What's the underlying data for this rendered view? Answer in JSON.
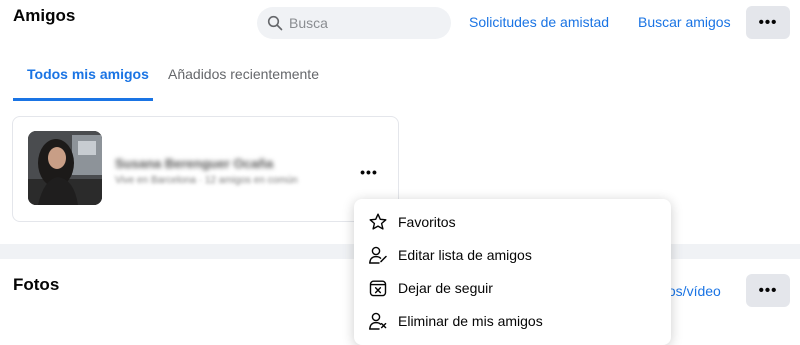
{
  "header": {
    "title": "Amigos",
    "search_placeholder": "Busca",
    "links": {
      "requests": "Solicitudes de amistad",
      "find": "Buscar amigos"
    },
    "more_label": "•••"
  },
  "tabs": [
    {
      "label": "Todos mis amigos",
      "active": true
    },
    {
      "label": "Añadidos recientemente",
      "active": false
    }
  ],
  "friend_card": {
    "name": "Susana Berenguer Ocaña",
    "meta": "Vive en Barcelona · 12 amigos en común",
    "more_label": "•••"
  },
  "context_menu": {
    "items": [
      {
        "label": "Favoritos",
        "icon": "star-icon"
      },
      {
        "label": "Editar lista de amigos",
        "icon": "edit-friend-list-icon"
      },
      {
        "label": "Dejar de seguir",
        "icon": "unfollow-icon"
      },
      {
        "label": "Eliminar de mis amigos",
        "icon": "remove-friend-icon"
      }
    ]
  },
  "photos_section": {
    "title": "Fotos",
    "link": "tos/vídeo",
    "more_label": "•••"
  },
  "colors": {
    "accent": "#1a74e4",
    "background": "#f0f2f5",
    "button_gray": "#e4e6eb"
  }
}
